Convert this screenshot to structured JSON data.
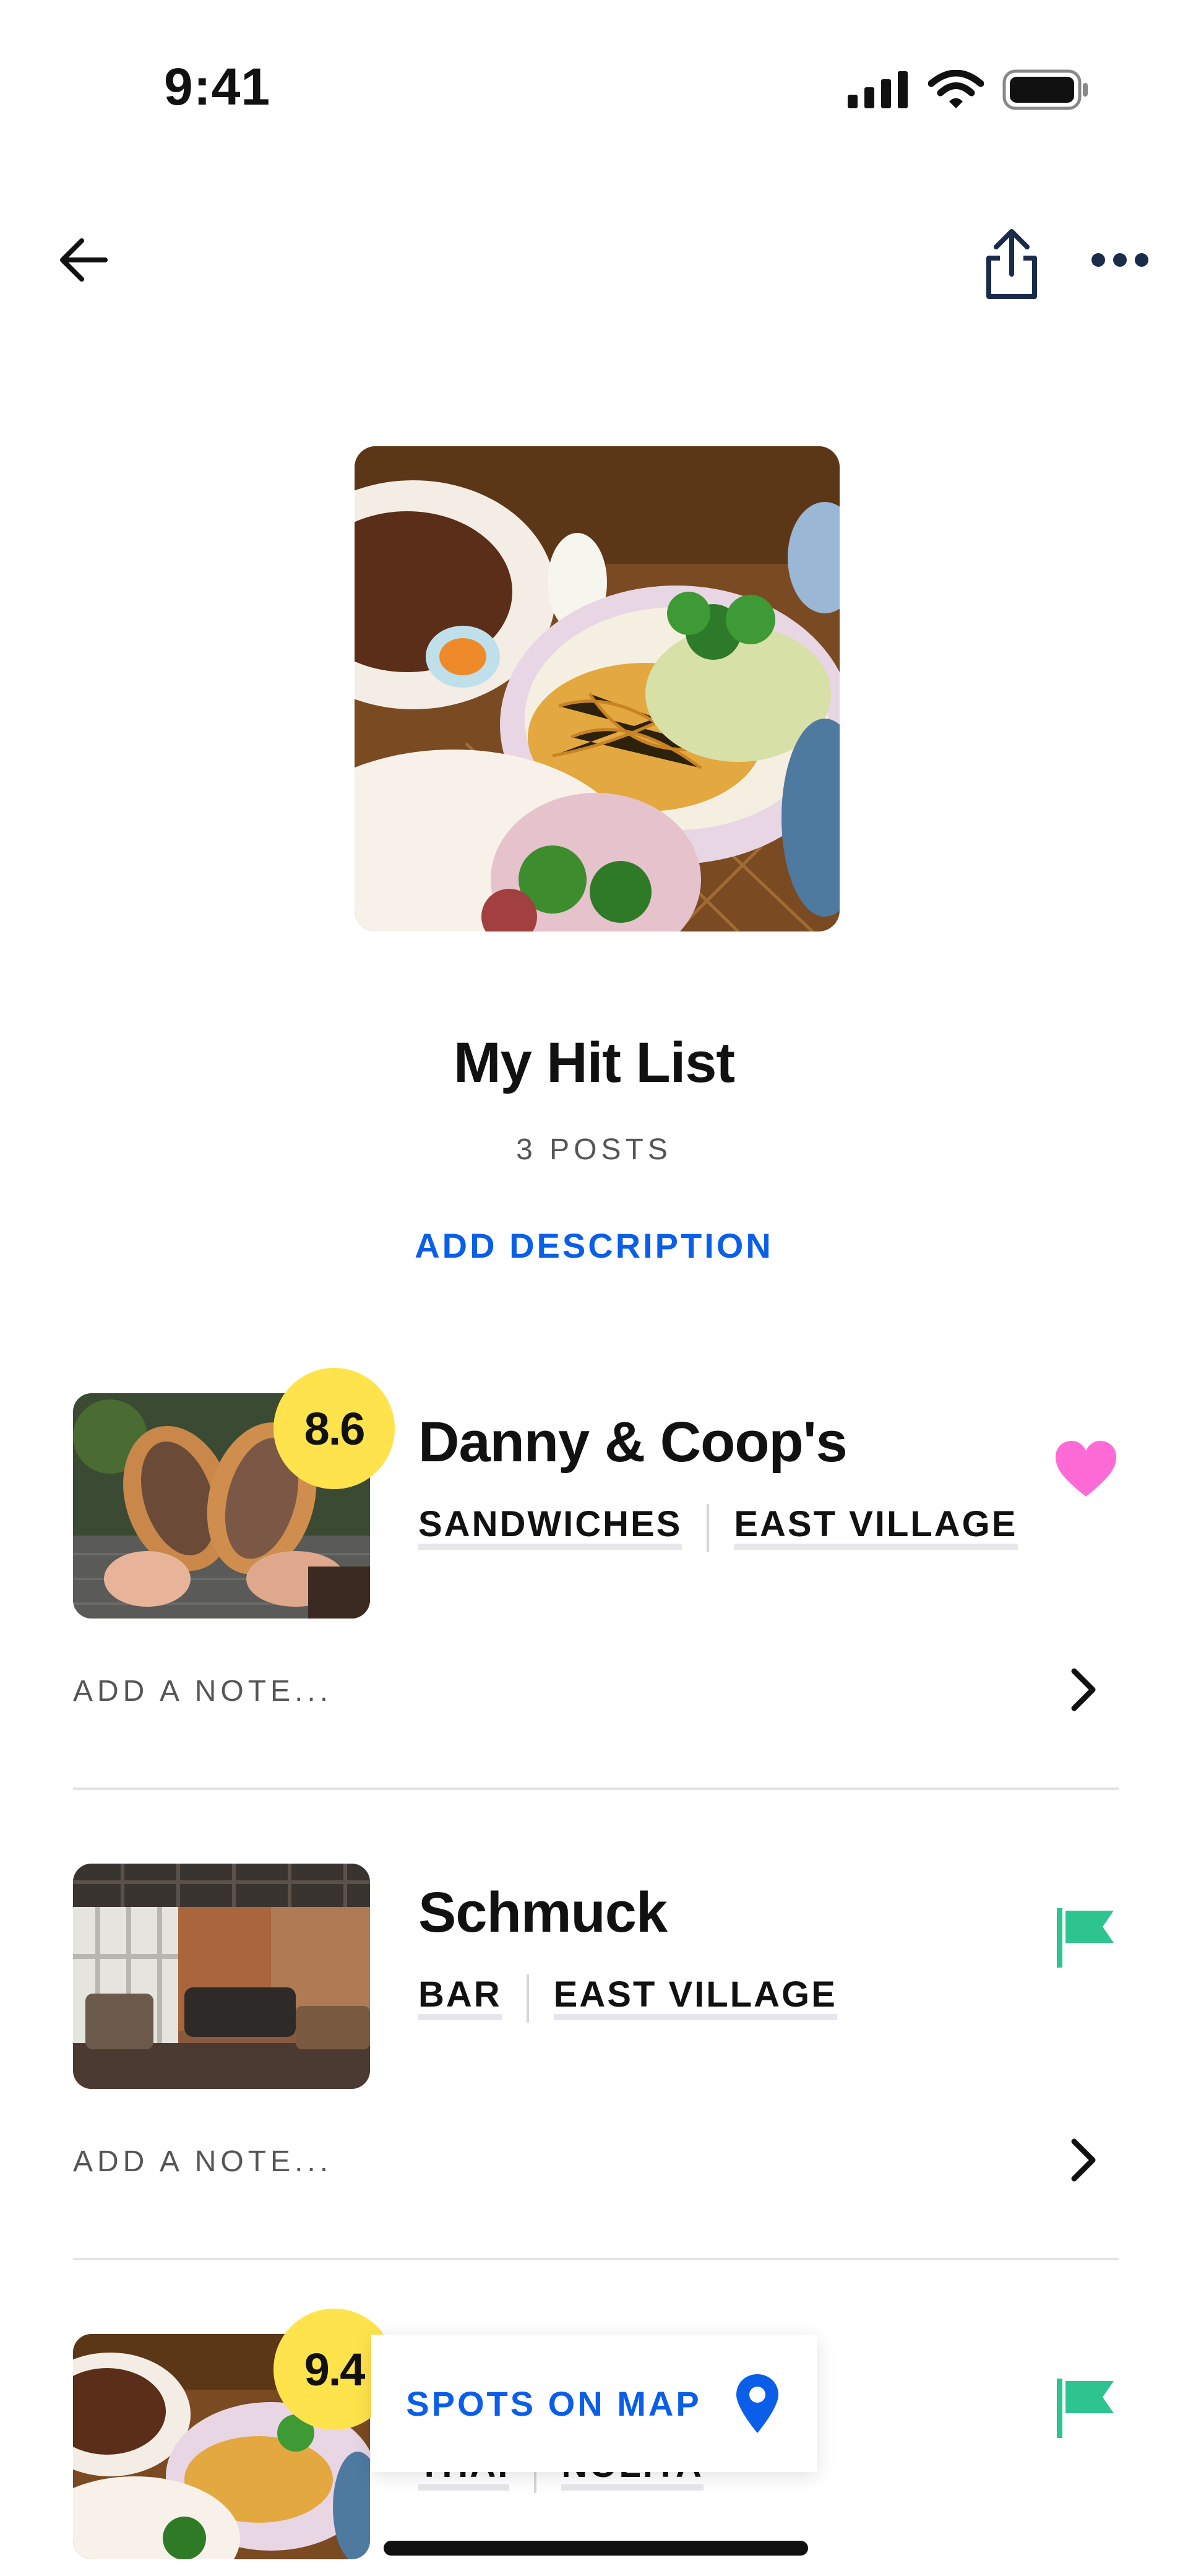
{
  "status_bar": {
    "time": "9:41"
  },
  "list": {
    "title": "My Hit List",
    "post_count": "3 POSTS",
    "add_description": "ADD DESCRIPTION"
  },
  "posts": [
    {
      "name": "Danny & Coop's",
      "score": "8.6",
      "tags": [
        "SANDWICHES",
        "EAST VILLAGE"
      ],
      "note_placeholder": "ADD A NOTE...",
      "status_icon": "heart-icon",
      "status_color": "#ff6bd6"
    },
    {
      "name": "Schmuck",
      "score": "",
      "tags": [
        "BAR",
        "EAST VILLAGE"
      ],
      "note_placeholder": "ADD A NOTE...",
      "status_icon": "flag-icon",
      "status_color": "#2ec48f"
    },
    {
      "name": "",
      "score": "9.4",
      "tags": [
        "THAI",
        "NOLITA"
      ],
      "status_icon": "flag-icon",
      "status_color": "#2ec48f"
    }
  ],
  "map_button": {
    "label": "SPOTS ON MAP",
    "icon": "map-pin-icon"
  },
  "colors": {
    "accent": "#0a5ee8",
    "score_badge": "#ffe34d"
  }
}
